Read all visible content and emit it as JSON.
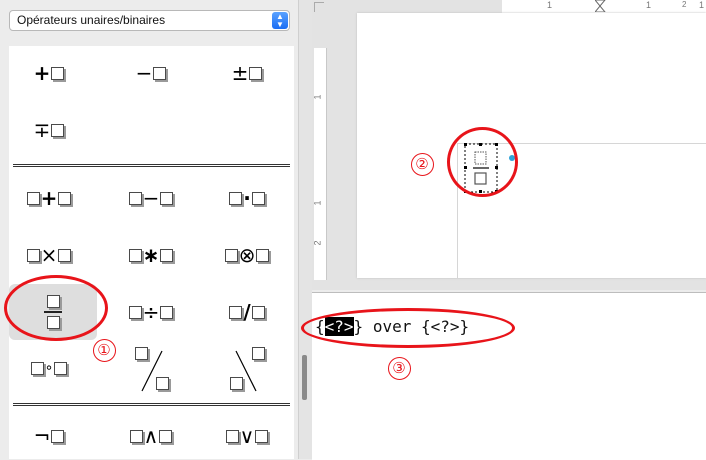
{
  "panel": {
    "category": "Opérateurs unaires/binaires"
  },
  "symbols": {
    "unary": [
      {
        "name": "plus-placeholder",
        "op": "+"
      },
      {
        "name": "minus-placeholder",
        "op": "−"
      },
      {
        "name": "plus-minus-placeholder",
        "op": "±"
      },
      {
        "name": "minus-plus-placeholder",
        "op": "∓"
      }
    ],
    "binary": [
      {
        "name": "addition",
        "op": "+"
      },
      {
        "name": "subtraction",
        "op": "−"
      },
      {
        "name": "multiplication-dot",
        "op": "·"
      },
      {
        "name": "multiplication-x",
        "op": "×"
      },
      {
        "name": "multiplication-star",
        "op": "∗"
      },
      {
        "name": "tensor-product",
        "op": "⊗"
      },
      {
        "name": "fraction",
        "op": ""
      },
      {
        "name": "division",
        "op": "÷"
      },
      {
        "name": "slash",
        "op": "/"
      },
      {
        "name": "concatenate",
        "op": "∘"
      },
      {
        "name": "wide-slash",
        "op": ""
      },
      {
        "name": "wide-backslash",
        "op": ""
      }
    ],
    "logic": [
      {
        "name": "boolean-not",
        "op": "¬"
      },
      {
        "name": "boolean-and",
        "op": "∧"
      },
      {
        "name": "boolean-or",
        "op": "∨"
      }
    ]
  },
  "ruler": {
    "h_marks": [
      "1",
      "1",
      "2",
      "1"
    ],
    "v_marks": [
      "1",
      "1",
      "2"
    ]
  },
  "command": {
    "open1": "{",
    "selected": "<?>",
    "rest": "} over {<?>}"
  },
  "annotations": [
    "①",
    "②",
    "③"
  ],
  "colors": {
    "annotation": "#e8141a",
    "select_accent": "#1a6df4"
  }
}
